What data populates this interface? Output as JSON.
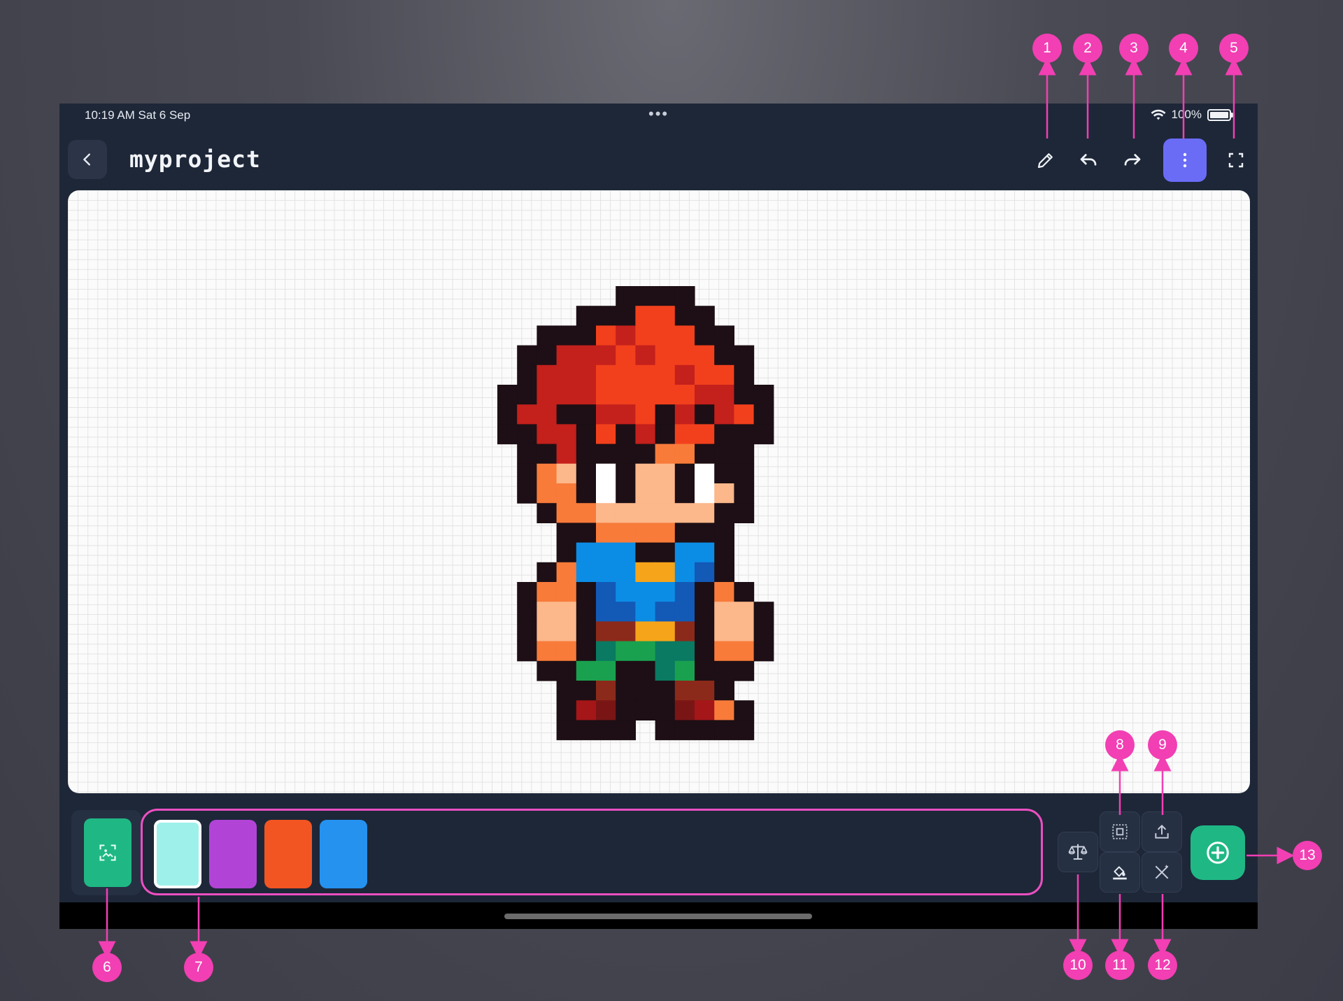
{
  "statusbar": {
    "time": "10:19 AM   Sat 6 Sep",
    "battery_text": "100%",
    "multitask_dots": "•••"
  },
  "header": {
    "title": "myproject"
  },
  "toolbar": {
    "icons": [
      "pencil-icon",
      "undo-icon",
      "redo-icon",
      "more-vertical-icon",
      "fullscreen-icon"
    ],
    "menu_bg": "#6a6cf6"
  },
  "palette": {
    "swatches": [
      "#9ef0ea",
      "#b144d6",
      "#f25522",
      "#2592f0"
    ],
    "selected_index": 0
  },
  "colors": {
    "accent_green": "#1fb885",
    "annotation_pink": "#f23fb3",
    "panel_bg": "#1d2738"
  },
  "callouts": [
    "1",
    "2",
    "3",
    "4",
    "5",
    "6",
    "7",
    "8",
    "9",
    "10",
    "11",
    "12",
    "13"
  ]
}
